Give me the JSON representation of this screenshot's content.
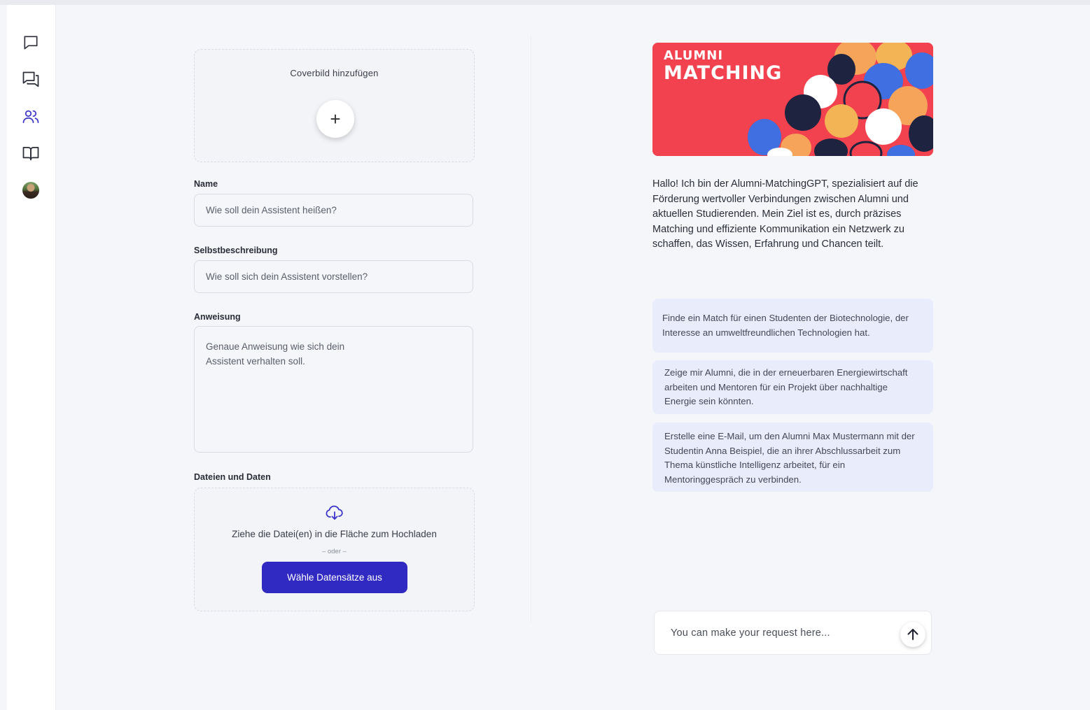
{
  "sidebar": {
    "items": [
      {
        "icon": "chat-bubble-icon"
      },
      {
        "icon": "conversations-icon"
      },
      {
        "icon": "users-icon",
        "active": true
      },
      {
        "icon": "book-icon"
      },
      {
        "icon": "avatar"
      }
    ],
    "active_color": "#3b34c9"
  },
  "form": {
    "cover_label": "Coverbild hinzufügen",
    "add_symbol": "+",
    "name_label": "Name",
    "name_placeholder": "Wie soll dein Assistent heißen?",
    "description_label": "Selbstbeschreibung",
    "description_placeholder": "Wie soll sich dein Assistent vorstellen?",
    "instruction_label": "Anweisung",
    "instruction_placeholder": "Genaue Anweisung wie sich dein Assistent verhalten soll.",
    "files_label": "Dateien und Daten",
    "upload_text": "Ziehe die Datei(en) in die Fläche zum Hochladen",
    "upload_or": "– oder –",
    "select_button": "Wähle Datensätze aus",
    "accent_color": "#3029c2"
  },
  "preview": {
    "banner_line1": "ALUMNI",
    "banner_line2": "MATCHING",
    "intro": "Hallo! Ich bin der Alumni-MatchingGPT, spezialisiert auf die Förderung wertvoller Verbindungen zwischen Alumni und aktuellen Studierenden. Mein Ziel ist es, durch präzises Matching und effiziente Kommunikation ein Netzwerk zu schaffen, das Wissen, Erfahrung und Chancen teilt.",
    "suggestions": [
      "Finde ein Match für einen Studenten der Biotechnologie, der Interesse an umweltfreundlichen Technologien hat.",
      "Zeige mir Alumni, die in der erneuerbaren Energiewirtschaft arbeiten und Mentoren für ein Projekt über nachhaltige Energie sein könnten.",
      "Erstelle eine E-Mail, um den Alumni Max Mustermann mit der Studentin Anna Beispiel, die an ihrer Abschlussarbeit zum Thema künstliche Intelligenz arbeitet, für ein Mentoringgespräch zu verbinden."
    ],
    "chat_placeholder": "You can make your request here..."
  }
}
